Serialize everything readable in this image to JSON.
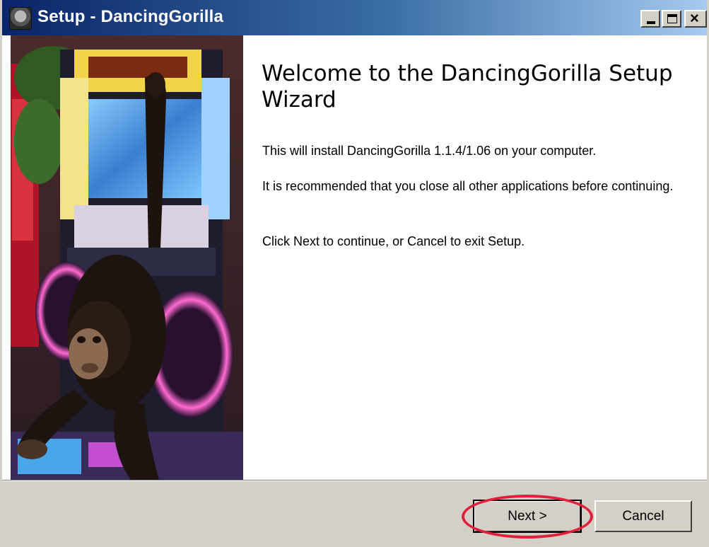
{
  "window": {
    "title": "Setup - DancingGorilla",
    "controls": {
      "minimize": "minimize",
      "maximize": "maximize",
      "close": "close"
    }
  },
  "wizard": {
    "heading": "Welcome to the DancingGorilla Setup Wizard",
    "paragraphs": [
      "This will install DancingGorilla 1.1.4/1.06 on your computer.",
      "It is recommended that you close all other applications before continuing.",
      "Click Next to continue, or Cancel to exit Setup."
    ]
  },
  "buttons": {
    "next_label": "Next >",
    "cancel_label": "Cancel"
  },
  "colors": {
    "titlebar_start": "#0a246a",
    "titlebar_end": "#a6caf0",
    "highlight": "#e0203a",
    "dialog_face": "#d4d0c8"
  }
}
